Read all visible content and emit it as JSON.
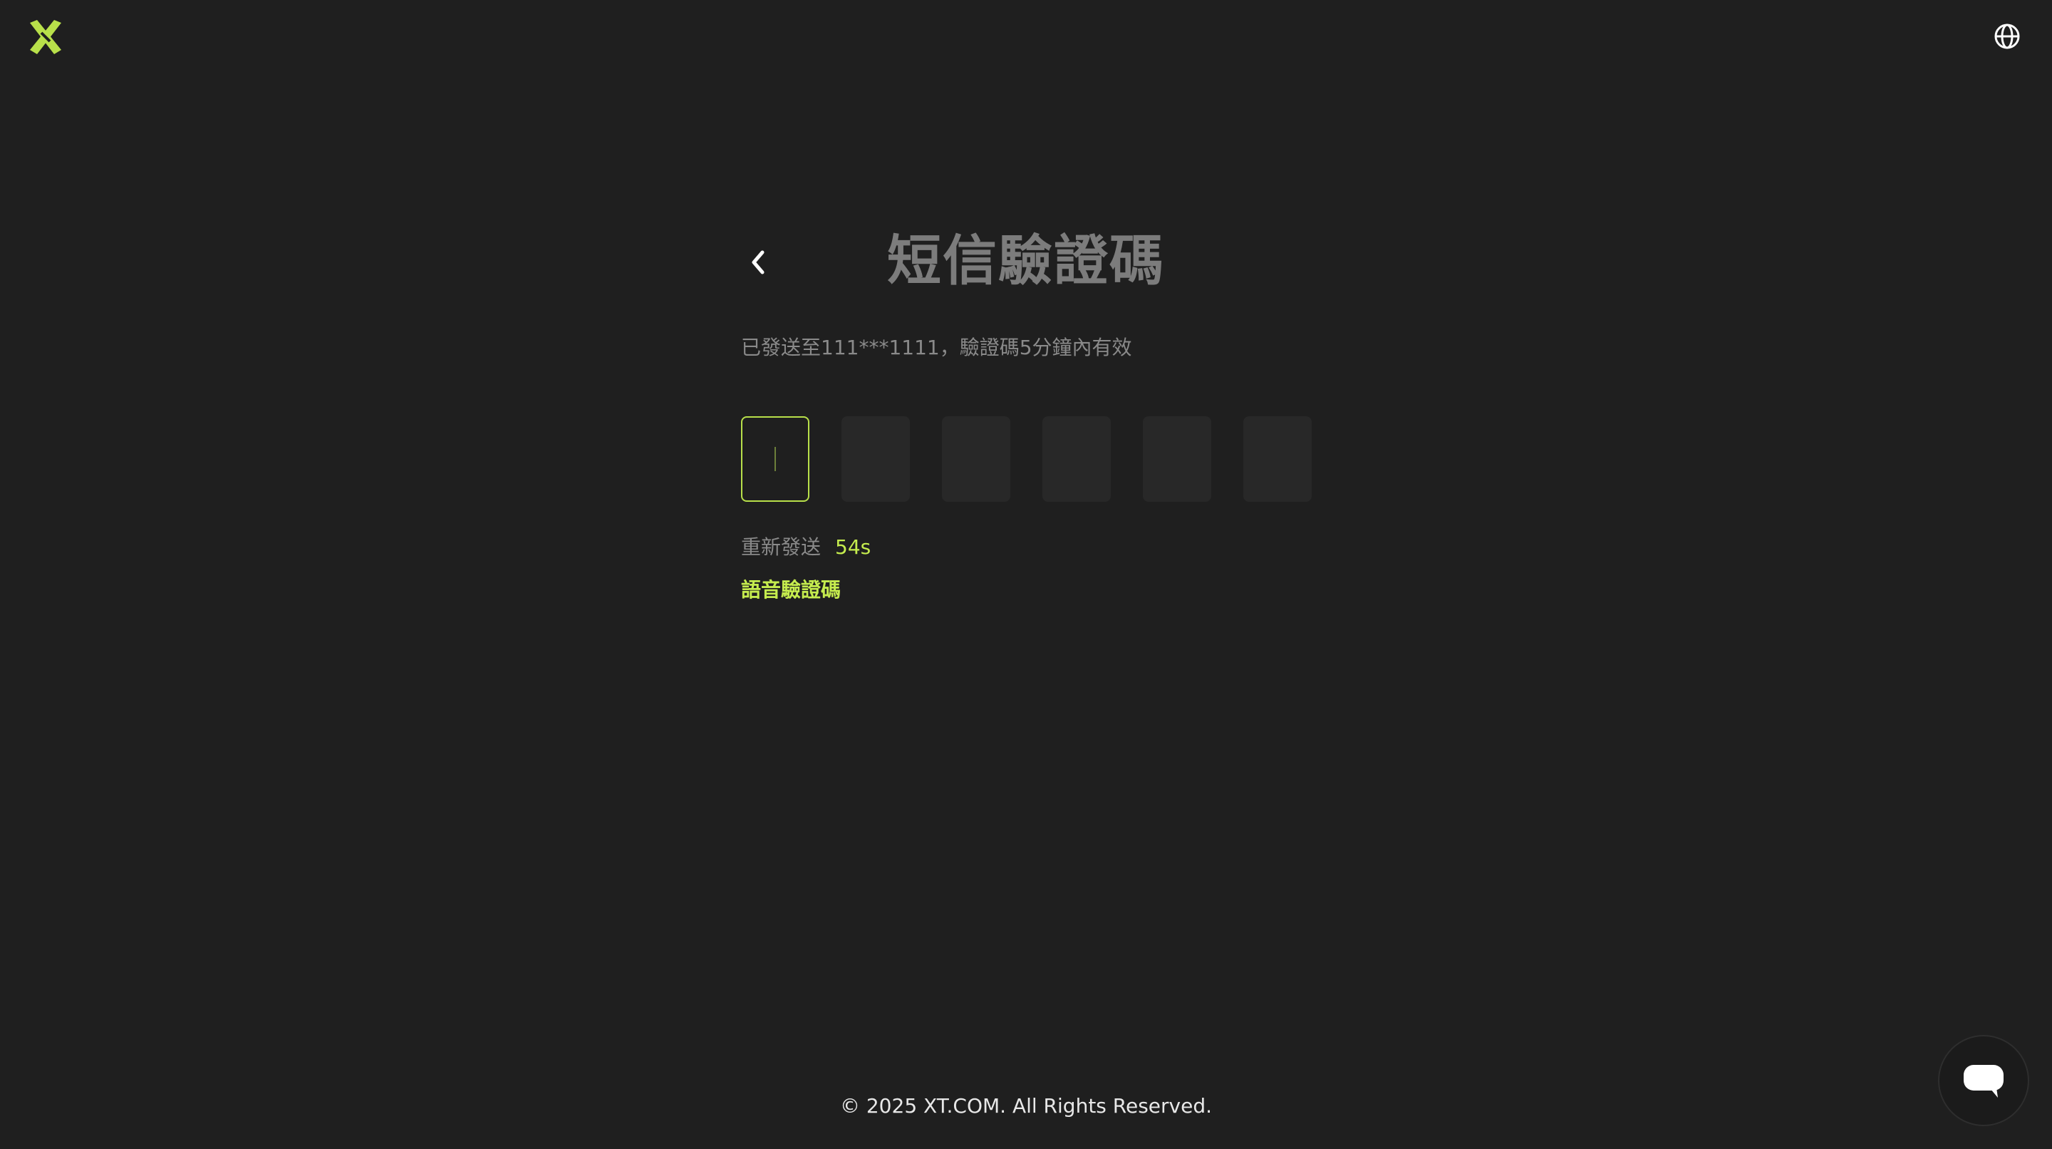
{
  "brand": {
    "accent_color": "#c5ec4e",
    "logo_icon": "xt-logo-icon"
  },
  "header": {
    "language_icon": "globe-icon"
  },
  "verification": {
    "back_icon": "chevron-left-icon",
    "title": "短信驗證碼",
    "subtitle": "已發送至111***1111，驗證碼5分鐘內有效",
    "code_length": 6,
    "resend_label": "重新發送",
    "resend_timer": "54s",
    "voice_link": "語音驗證碼"
  },
  "footer": {
    "copyright": "© 2025 XT.COM. All Rights Reserved."
  },
  "support": {
    "chat_icon": "chat-bubble-icon"
  }
}
